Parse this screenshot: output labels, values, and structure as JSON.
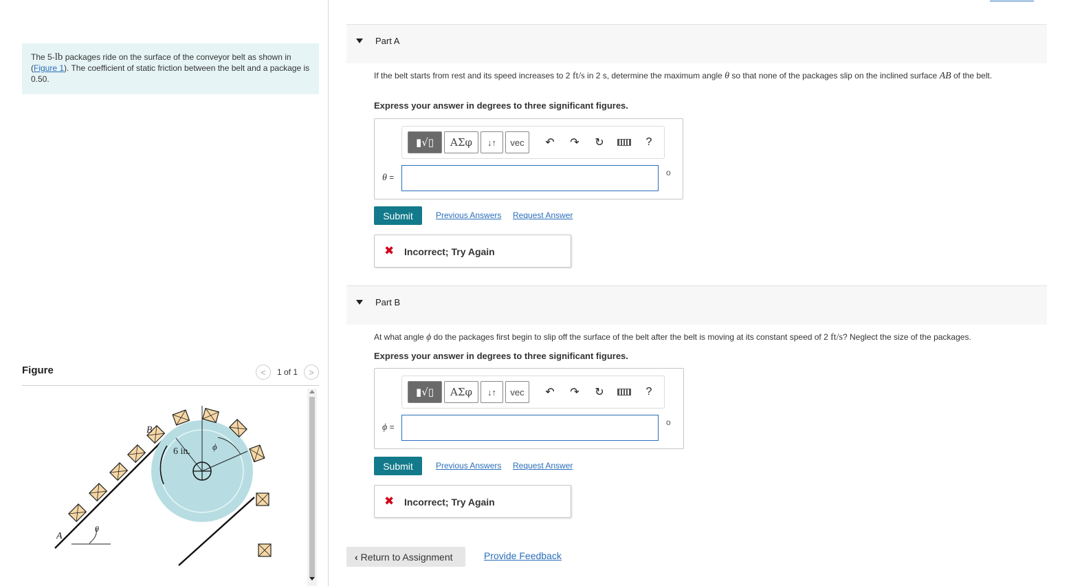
{
  "problem": {
    "text_prefix": "The 5-",
    "weight_unit": "lb",
    "text_mid": " packages ride on the surface of the conveyor belt as shown in (",
    "figure_link": "Figure 1",
    "text_suffix": "). The coefficient of static friction between the belt and a package is 0.50."
  },
  "figure": {
    "title": "Figure",
    "counter": "1 of 1",
    "labels": {
      "a": "A",
      "b": "B",
      "radius": "6 in.",
      "theta": "θ",
      "phi": "ϕ"
    }
  },
  "part_a": {
    "label": "Part A",
    "question_1": "If the belt starts from rest and its speed increases to 2 ",
    "unit": "ft/s",
    "question_2": " in 2 s, determine the maximum angle ",
    "symbol": "θ",
    "question_3": " so that none of the packages slip on the inclined surface ",
    "surface": "AB",
    "question_4": " of the belt.",
    "instruction": "Express your answer in degrees to three significant figures.",
    "eq_symbol": "θ",
    "eq_sign": " =",
    "input_value": "",
    "unit_symbol": "o",
    "submit": "Submit",
    "previous_answers": "Previous Answers",
    "request_answer": "Request Answer",
    "feedback_icon": "✖",
    "feedback": "Incorrect; Try Again"
  },
  "part_b": {
    "label": "Part B",
    "question_1": "At what angle ",
    "symbol": "ϕ",
    "question_2": " do the packages first begin to slip off the surface of the belt after the belt is moving at its constant speed of 2 ",
    "unit": "ft/s",
    "question_3": "? Neglect the size of the packages.",
    "instruction": "Express your answer in degrees to three significant figures.",
    "eq_symbol": "ϕ",
    "eq_sign": " =",
    "input_value": "",
    "unit_symbol": "o",
    "submit": "Submit",
    "previous_answers": "Previous Answers",
    "request_answer": "Request Answer",
    "feedback_icon": "✖",
    "feedback": "Incorrect; Try Again"
  },
  "toolbar": {
    "templates": "▮√▯",
    "greek": "ΑΣφ",
    "arrows": "↓↑",
    "vec": "vec",
    "undo_icon": "undo-icon",
    "redo_icon": "redo-icon",
    "reset_icon": "reset-icon",
    "keyboard_icon": "keyboard-icon",
    "help": "?"
  },
  "footer": {
    "return": "Return to Assignment",
    "feedback": "Provide Feedback"
  },
  "nav": {
    "prev": "<",
    "next": ">"
  },
  "colors": {
    "submit": "#127a8a",
    "link": "#2a6ebb",
    "error": "#d0021b",
    "problem_bg": "#e6f4f5"
  }
}
